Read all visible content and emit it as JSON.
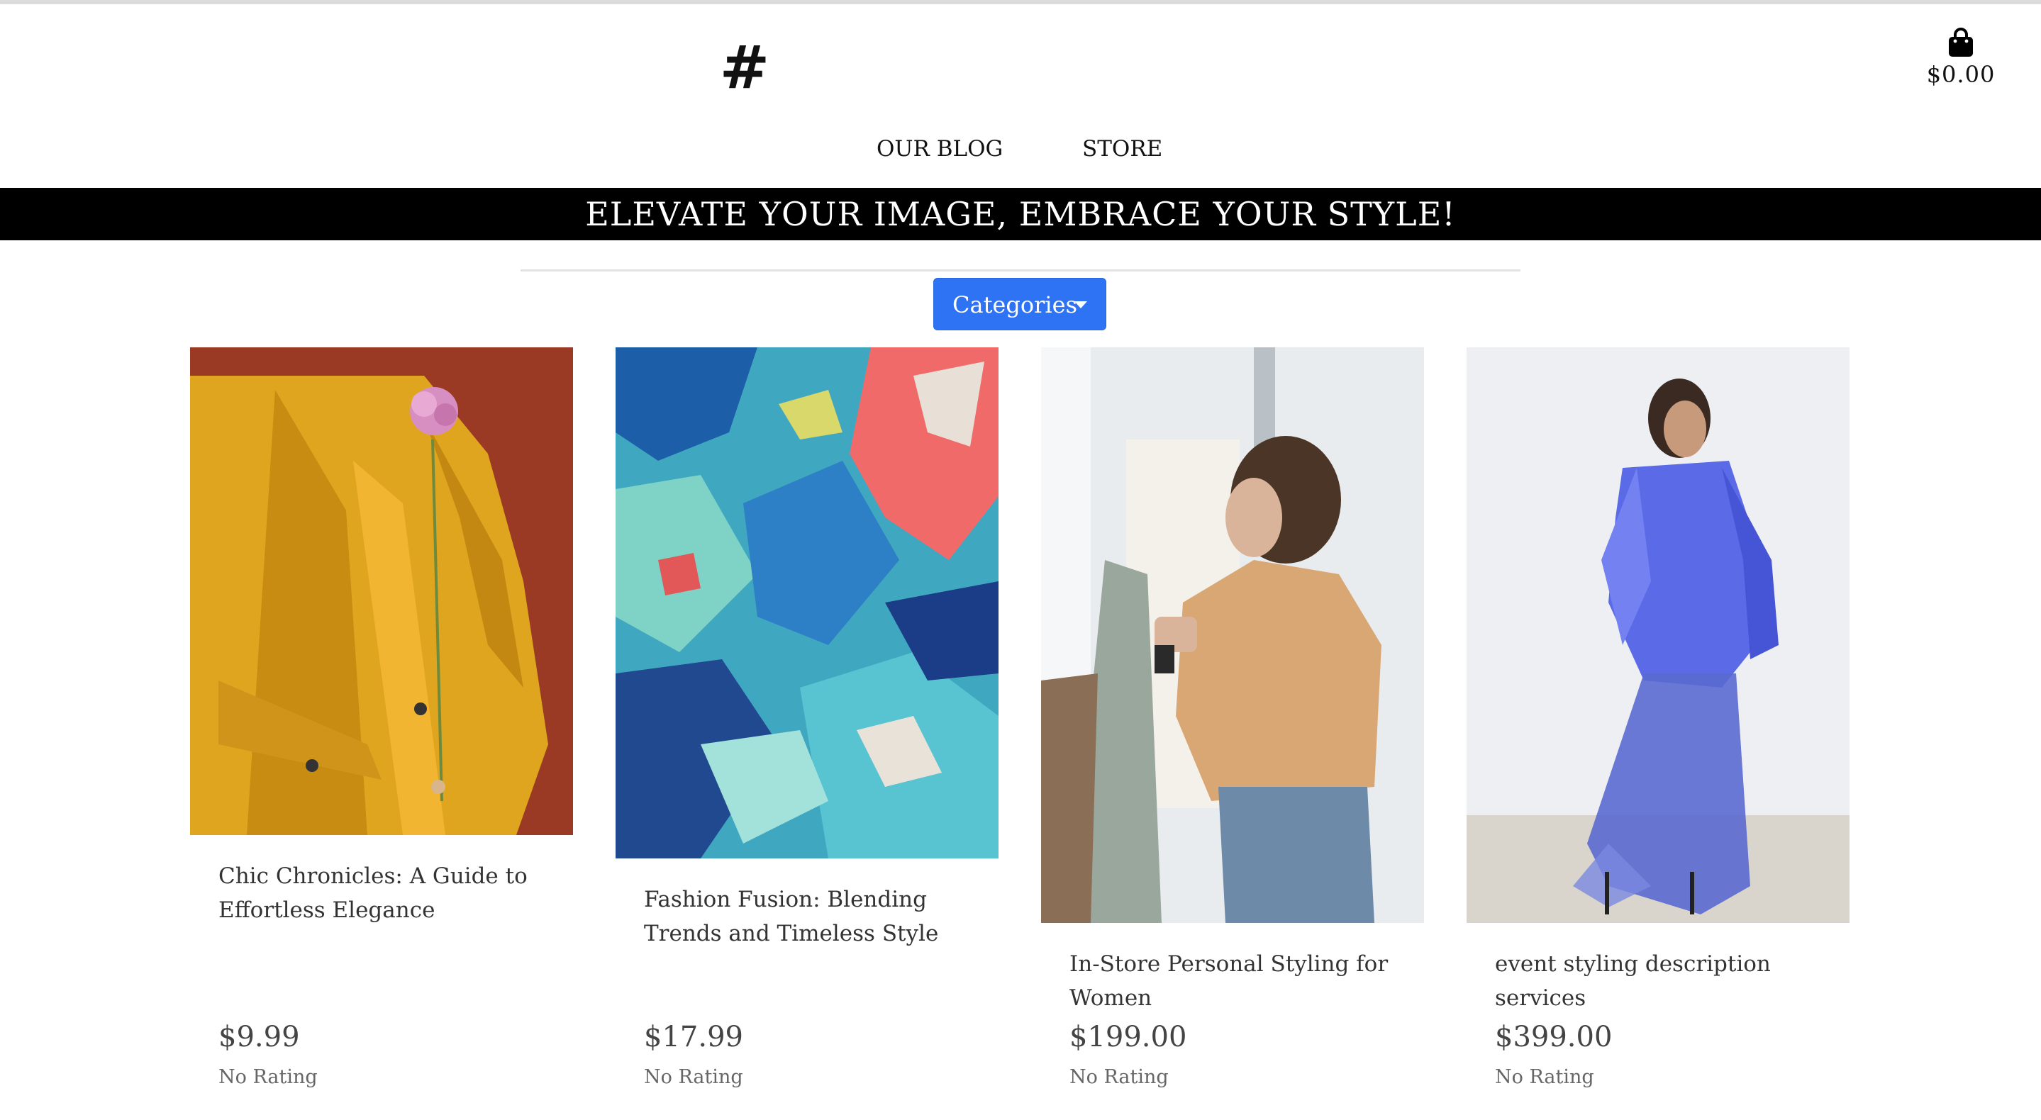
{
  "header": {
    "logo_text": "#",
    "cart_total": "$0.00",
    "cart_icon": "shopping-bag-icon"
  },
  "nav": {
    "items": [
      {
        "label": "OUR BLOG"
      },
      {
        "label": "STORE"
      }
    ]
  },
  "banner": {
    "text": "ELEVATE YOUR IMAGE, EMBRACE YOUR STYLE!"
  },
  "filters": {
    "categories_label": "Categories",
    "button_color": "#2f73f5"
  },
  "products": [
    {
      "title": "Chic Chronicles: A Guide to Effortless Elegance",
      "price": "$9.99",
      "rating": "No Rating"
    },
    {
      "title": "Fashion Fusion: Blending Trends and Timeless Style",
      "price": "$17.99",
      "rating": "No Rating"
    },
    {
      "title": "In-Store Personal Styling for Women",
      "price": "$199.00",
      "rating": "No Rating"
    },
    {
      "title": "event styling description services",
      "price": "$399.00",
      "rating": "No Rating"
    }
  ]
}
